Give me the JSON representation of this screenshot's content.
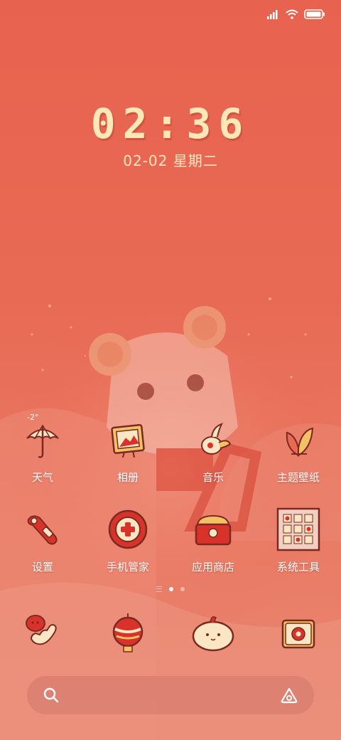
{
  "status": {
    "signal_icon": "signal-icon",
    "wifi_icon": "wifi-icon",
    "battery_icon": "battery-icon"
  },
  "lockclock": {
    "time": "02:36",
    "date": "02-02 星期二"
  },
  "apps_row1": [
    {
      "label": "天气",
      "icon": "umbrella-icon",
      "extra": "-2°"
    },
    {
      "label": "相册",
      "icon": "photo-frame-icon"
    },
    {
      "label": "音乐",
      "icon": "music-bird-icon"
    },
    {
      "label": "主题壁纸",
      "icon": "leaf-icon"
    }
  ],
  "apps_row2": [
    {
      "label": "设置",
      "icon": "wrench-icon"
    },
    {
      "label": "手机管家",
      "icon": "plus-shield-icon"
    },
    {
      "label": "应用商店",
      "icon": "red-envelope-icon"
    },
    {
      "label": "系统工具",
      "icon": "tools-grid-icon"
    }
  ],
  "dock": [
    {
      "icon": "phone-icon"
    },
    {
      "icon": "browser-lantern-icon"
    },
    {
      "icon": "message-bird-icon"
    },
    {
      "icon": "camera-icon"
    }
  ],
  "page_indicator": {
    "pages": 3,
    "active": 1
  },
  "search": {
    "search_icon": "search-icon",
    "assistant_icon": "assistant-icon"
  },
  "colors": {
    "background": "#e8634f",
    "accent": "#ffe8b8",
    "icon_red": "#d8322a",
    "icon_cream": "#fbe6c4"
  }
}
